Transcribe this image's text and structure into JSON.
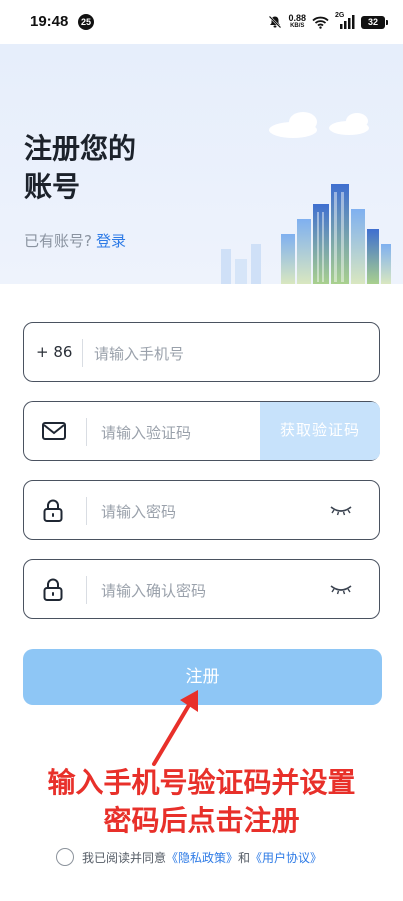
{
  "status_bar": {
    "time": "19:48",
    "badge": "25",
    "net_speed_value": "0.88",
    "net_speed_unit": "KB/S",
    "signal_label": "2G",
    "battery": "32"
  },
  "hero": {
    "title_line1": "注册您的",
    "title_line2": "账号",
    "has_account_text": "已有账号?",
    "login_link": "登录"
  },
  "form": {
    "phone_prefix": "+ 86",
    "phone_placeholder": "请输入手机号",
    "code_placeholder": "请输入验证码",
    "get_code_label": "获取验证码",
    "password_placeholder": "请输入密码",
    "confirm_password_placeholder": "请输入确认密码"
  },
  "register_label": "注册",
  "annotation": {
    "line1": "输入手机号验证码并设置",
    "line2": "密码后点击注册"
  },
  "agreement": {
    "prefix": "我已阅读并同意",
    "privacy_link": "《隐私政策》",
    "and": "和",
    "terms_link": "《用户协议》"
  },
  "colors": {
    "accent": "#2e7be6",
    "register_button": "#8ec6f5",
    "get_code_bg": "#c7e2fb",
    "annotation_red": "#e8302a"
  }
}
